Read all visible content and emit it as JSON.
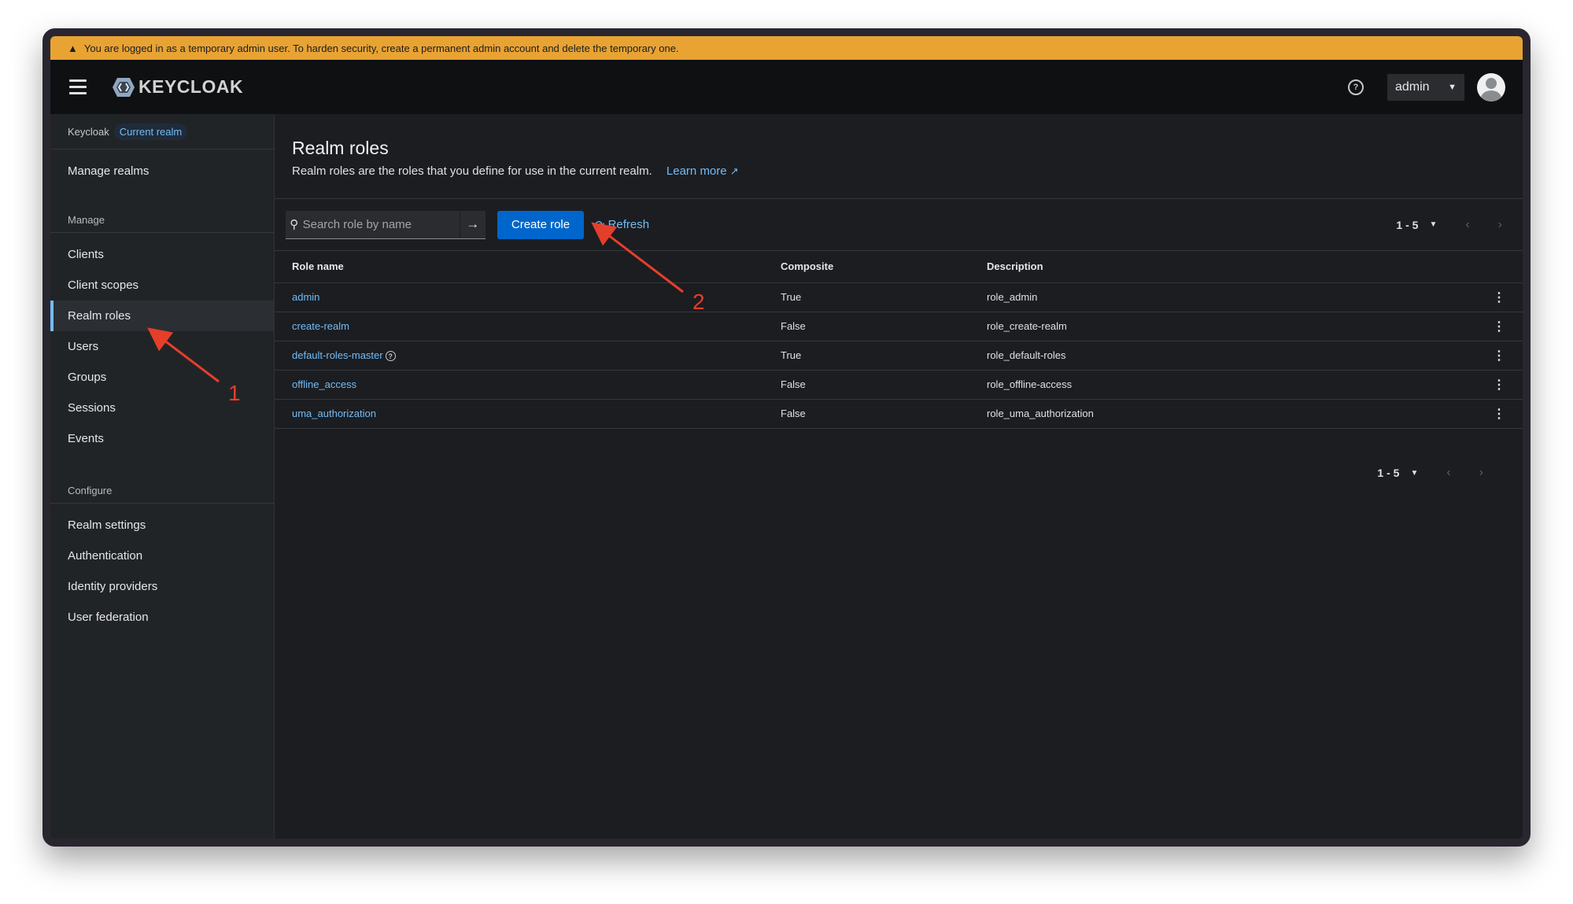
{
  "banner": {
    "icon": "warning-icon",
    "text": "You are logged in as a temporary admin user. To harden security, create a permanent admin account and delete the temporary one."
  },
  "header": {
    "brand": "KEYCLOAK",
    "user": "admin"
  },
  "sidebar": {
    "realm_label": "Keycloak",
    "realm_badge": "Current realm",
    "manage_realms": "Manage realms",
    "manage_group": "Manage",
    "manage_items": [
      "Clients",
      "Client scopes",
      "Realm roles",
      "Users",
      "Groups",
      "Sessions",
      "Events"
    ],
    "configure_group": "Configure",
    "configure_items": [
      "Realm settings",
      "Authentication",
      "Identity providers",
      "User federation"
    ],
    "active": "Realm roles"
  },
  "page": {
    "title": "Realm roles",
    "description": "Realm roles are the roles that you define for use in the current realm.",
    "learn_more": "Learn more"
  },
  "toolbar": {
    "search_placeholder": "Search role by name",
    "create_label": "Create role",
    "refresh_label": "Refresh",
    "pager_range": "1 - 5"
  },
  "table": {
    "headers": [
      "Role name",
      "Composite",
      "Description"
    ],
    "rows": [
      {
        "name": "admin",
        "composite": "True",
        "description": "role_admin"
      },
      {
        "name": "create-realm",
        "composite": "False",
        "description": "role_create-realm"
      },
      {
        "name": "default-roles-master",
        "composite": "True",
        "description": "role_default-roles"
      },
      {
        "name": "offline_access",
        "composite": "False",
        "description": "role_offline-access"
      },
      {
        "name": "uma_authorization",
        "composite": "False",
        "description": "role_uma_authorization"
      }
    ]
  },
  "bottom_pager": {
    "range": "1 - 5"
  },
  "annotations": [
    "1",
    "2"
  ],
  "colors": {
    "accent": "#73bcf7",
    "primary_button": "#0066cc",
    "banner": "#e8a333",
    "annotation": "#e53e2b"
  }
}
